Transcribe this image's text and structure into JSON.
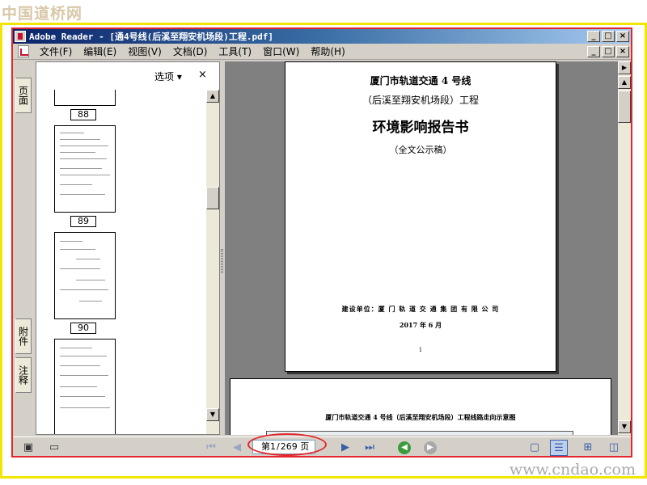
{
  "watermarks": {
    "top": "中国道桥网",
    "bottom": "www.cndao.com"
  },
  "window": {
    "title": "Adobe Reader - [通4号线(后溪至翔安机场段)工程.pdf]",
    "buttons": {
      "minimize": "_",
      "restore": "□",
      "close": "×"
    }
  },
  "menu": {
    "items": [
      "文件(F)",
      "编辑(E)",
      "视图(V)",
      "文档(D)",
      "工具(T)",
      "窗口(W)",
      "帮助(H)"
    ]
  },
  "side_tabs": {
    "pages": "页面",
    "attachments": "附件",
    "comments": "注释"
  },
  "thumbnails": {
    "options_label": "选项",
    "close_label": "×",
    "page_numbers": [
      "88",
      "89",
      "90"
    ]
  },
  "document": {
    "page1": {
      "line1": "厦门市轨道交通 4 号线",
      "line2": "（后溪至翔安机场段）工程",
      "title": "环境影响报告书",
      "subtitle": "（全文公示稿）",
      "builder": "建设单位：厦 门 轨 道 交 通 集 团 有 限 公 司",
      "date": "2017 年 6 月",
      "number": "1"
    },
    "page2": {
      "title": "厦门市轨道交通 4 号线（后溪至翔安机场段）工程线路走向示意图"
    }
  },
  "statusbar": {
    "page_prefix": "第",
    "current_page": "1",
    "separator": "/",
    "total_pages": "269",
    "page_suffix": "页"
  },
  "colors": {
    "window_border": "#e3262b",
    "outer_frame": "#f2e600",
    "title_bar": "#0a246a"
  }
}
